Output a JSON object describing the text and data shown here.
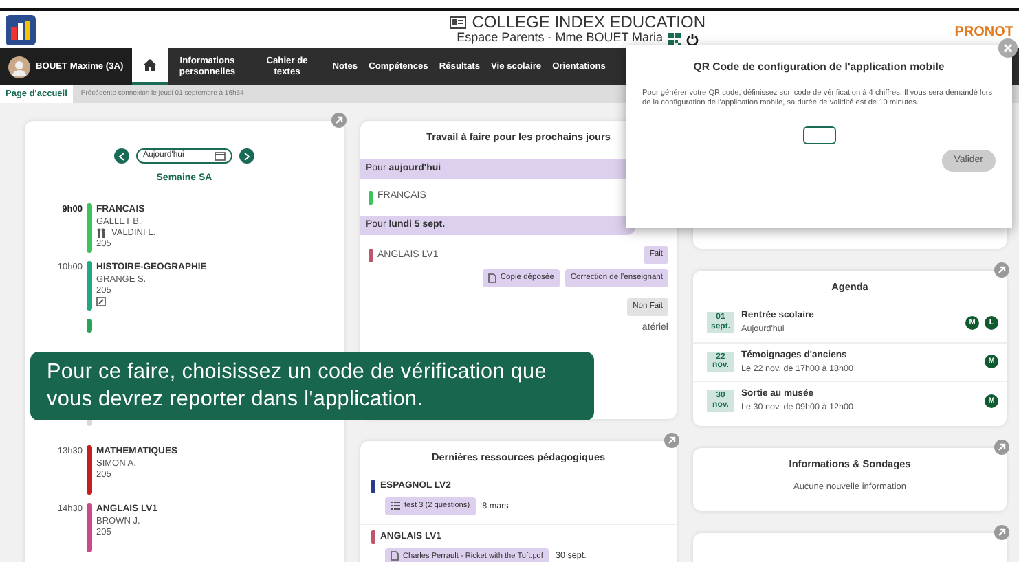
{
  "header": {
    "title": "COLLEGE INDEX EDUCATION",
    "subtitle": "Espace Parents - Mme BOUET Maria",
    "brand": "PRONOT"
  },
  "nav": {
    "student": "BOUET Maxime (3A)",
    "tabs": [
      {
        "kind": "home",
        "selected": true
      },
      {
        "kind": "text",
        "label": "Informations personnelles",
        "selected": false
      },
      {
        "kind": "text",
        "label": "Cahier de textes",
        "selected": false
      },
      {
        "kind": "text",
        "label": "Notes",
        "selected": false
      },
      {
        "kind": "text",
        "label": "Compétences",
        "selected": false
      },
      {
        "kind": "text",
        "label": "Résultats",
        "selected": false
      },
      {
        "kind": "text",
        "label": "Vie scolaire",
        "selected": false
      },
      {
        "kind": "text",
        "label": "Orientations",
        "selected": false
      }
    ]
  },
  "breadcrumb": {
    "page": "Page d'accueil",
    "last_login": "Précédente connexion le jeudi 01 septembre à 16h54"
  },
  "timetable": {
    "date": "Aujourd'hui",
    "week": "Semaine SA",
    "lessons": [
      {
        "kind": "lesson",
        "time": "9h00",
        "current": true,
        "color": "#3cc35a",
        "subject": "FRANCAIS",
        "lines": [
          {
            "kind": "text",
            "text": "GALLET B."
          },
          {
            "kind": "companion",
            "text": "VALDINI L."
          },
          {
            "kind": "text",
            "text": "205"
          }
        ]
      },
      {
        "kind": "lesson",
        "time": "10h00",
        "current": false,
        "color": "#1fa882",
        "subject": "HISTOIRE-GEOGRAPHIE",
        "lines": [
          {
            "kind": "text",
            "text": "GRANGE S."
          },
          {
            "kind": "text",
            "text": "205"
          },
          {
            "kind": "edit"
          }
        ]
      },
      {
        "kind": "hidden",
        "color": "#27a35a"
      },
      {
        "kind": "pause",
        "color": "#d8d8d8"
      },
      {
        "kind": "lesson",
        "time": "13h30",
        "current": false,
        "color": "#c41f1f",
        "subject": "MATHEMATIQUES",
        "lines": [
          {
            "kind": "text",
            "text": "SIMON A."
          },
          {
            "kind": "text",
            "text": "205"
          }
        ]
      },
      {
        "kind": "lesson",
        "time": "14h30",
        "current": false,
        "color": "#c94a86",
        "subject": "ANGLAIS LV1",
        "lines": [
          {
            "kind": "text",
            "text": "BROWN J."
          },
          {
            "kind": "text",
            "text": "205"
          }
        ]
      }
    ]
  },
  "homework": {
    "title": "Travail à faire pour les prochains jours",
    "groups": [
      {
        "label": "Pour **aujourd'hui**",
        "items": [
          {
            "subject": "FRANCAIS",
            "color": "#3cc35a"
          }
        ]
      },
      {
        "label": "Pour **lundi 5 sept.**",
        "items": [
          {
            "subject": "ANGLAIS LV1",
            "color": "#c0566a",
            "status": "Fait",
            "done": true,
            "actions": [
              {
                "kind": "file",
                "label": "Copie déposée"
              },
              {
                "kind": "plain",
                "label": "Correction de l'enseignant"
              }
            ]
          },
          {
            "status": "Non Fait",
            "done": false,
            "note": "atériel"
          }
        ]
      }
    ]
  },
  "resources": {
    "title": "Dernières ressources pédagogiques",
    "items": [
      {
        "subject": "ESPAGNOL LV2",
        "color": "#2b3a8f",
        "kind": "quiz",
        "chip": "test 3 (2 questions)",
        "date": "8 mars"
      },
      {
        "subject": "ANGLAIS LV1",
        "color": "#c0566a",
        "kind": "file",
        "chip": "Charles Perrault - Ricket with the Tuft.pdf",
        "date": "30 sept."
      }
    ]
  },
  "agenda": {
    "title": "Agenda",
    "events": [
      {
        "day": "01",
        "month": "sept.",
        "title": "Rentrée scolaire",
        "detail": "Aujourd'hui",
        "tags": [
          "M",
          "L"
        ]
      },
      {
        "day": "22",
        "month": "nov.",
        "title": "Témoignages d'anciens",
        "detail": "Le 22 nov. de 17h00 à 18h00",
        "tags": [
          "M"
        ]
      },
      {
        "day": "30",
        "month": "nov.",
        "title": "Sortie au musée",
        "detail": "Le 30 nov. de 09h00 à 12h00",
        "tags": [
          "M"
        ]
      }
    ]
  },
  "information": {
    "title": "Informations & Sondages",
    "empty": "Aucune nouvelle information"
  },
  "dialog": {
    "title": "QR Code de configuration de l'application mobile",
    "text": "Pour générer votre QR code, définissez son code de vérification à 4 chiffres. Il vous sera demandé lors de la configuration de l'application mobile, sa durée de validité est de 10 minutes.",
    "button": {
      "label": "Valider",
      "disabled": true
    }
  },
  "caption": "Pour ce faire, choisissez un code de vérification que vous devrez reporter dans l'application."
}
